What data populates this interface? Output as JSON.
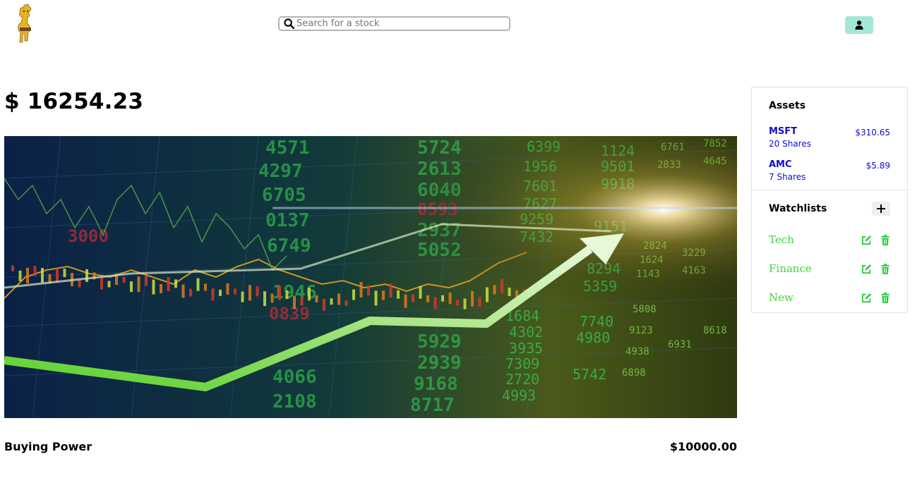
{
  "header": {
    "logo_icon": "golden-mascot-logo",
    "search": {
      "placeholder": "Search for a stock",
      "value": "",
      "icon": "search-icon"
    },
    "user_button_icon": "user-icon",
    "user_button_color": "#a6e6d6"
  },
  "portfolio": {
    "balance": "$ 16254.23",
    "hero_image": "stock-market-chart-upward-arrow",
    "buying_power_label": "Buying Power",
    "buying_power_value": "$10000.00"
  },
  "sidebar": {
    "assets_title": "Assets",
    "assets": [
      {
        "symbol": "MSFT",
        "shares": "20 Shares",
        "price": "$310.65"
      },
      {
        "symbol": "AMC",
        "shares": "7 Shares",
        "price": "$5.89"
      }
    ],
    "watchlists_title": "Watchlists",
    "add_icon": "plus-icon",
    "watchlists": [
      {
        "name": "Tech"
      },
      {
        "name": "Finance"
      },
      {
        "name": "New"
      }
    ],
    "colors": {
      "asset_text": "#0d0dcf",
      "watchlist_text": "#3ed43e",
      "icon_green": "#2ecc40"
    }
  }
}
